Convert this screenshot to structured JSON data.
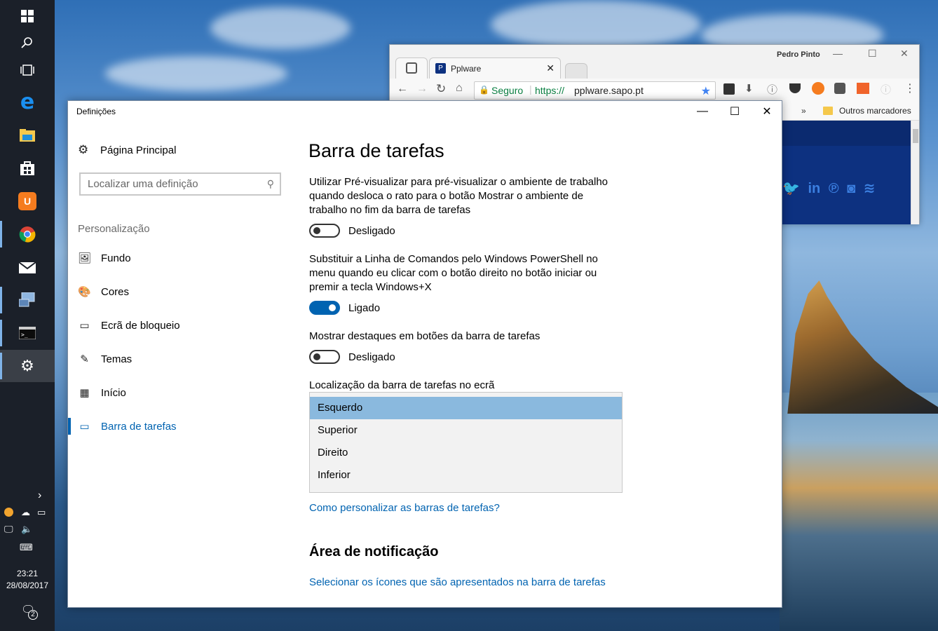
{
  "taskbar": {
    "icons": [
      "windows-start-icon",
      "search-icon",
      "task-view-icon",
      "edge-icon",
      "file-explorer-icon",
      "store-icon",
      "uc-browser-icon",
      "chrome-icon",
      "mail-icon",
      "remote-desktop-icon",
      "terminal-icon",
      "settings-icon"
    ],
    "time": "23:21",
    "date": "28/08/2017",
    "notif_count": "2"
  },
  "chrome": {
    "user": "Pedro Pinto",
    "tab_title": "Pplware",
    "secure_label": "Seguro",
    "url_prefix": "https://",
    "url_host": "pplware.sapo.pt",
    "bookmarks_more": "»",
    "other_bookmarks": "Outros marcadores"
  },
  "settings": {
    "window_title": "Definições",
    "home": "Página Principal",
    "search_placeholder": "Localizar uma definição",
    "section": "Personalização",
    "nav": [
      {
        "label": "Fundo",
        "icon": "picture-icon"
      },
      {
        "label": "Cores",
        "icon": "palette-icon"
      },
      {
        "label": "Ecrã de bloqueio",
        "icon": "lock-screen-icon"
      },
      {
        "label": "Temas",
        "icon": "themes-icon"
      },
      {
        "label": "Início",
        "icon": "start-icon"
      },
      {
        "label": "Barra de tarefas",
        "icon": "taskbar-icon"
      }
    ],
    "page_title": "Barra de tarefas",
    "option1": {
      "text": "Utilizar Pré-visualizar para pré-visualizar o ambiente de trabalho quando desloca o rato para o botão Mostrar o ambiente de trabalho no fim da barra de tarefas",
      "state": "Desligado",
      "on": false
    },
    "option2": {
      "text": "Substituir a Linha de Comandos pelo Windows PowerShell no menu quando eu clicar com o botão direito no botão iniciar ou premir a tecla Windows+X",
      "state": "Ligado",
      "on": true
    },
    "option3": {
      "text": "Mostrar destaques em botões da barra de tarefas",
      "state": "Desligado",
      "on": false
    },
    "location_label": "Localização da barra de tarefas no ecrã",
    "location_options": [
      "Esquerdo",
      "Superior",
      "Direito",
      "Inferior"
    ],
    "location_selected": "Esquerdo",
    "help_link": "Como personalizar as barras de tarefas?",
    "notif_heading": "Área de notificação",
    "notif_link": "Selecionar os ícones que são apresentados na barra de tarefas"
  }
}
